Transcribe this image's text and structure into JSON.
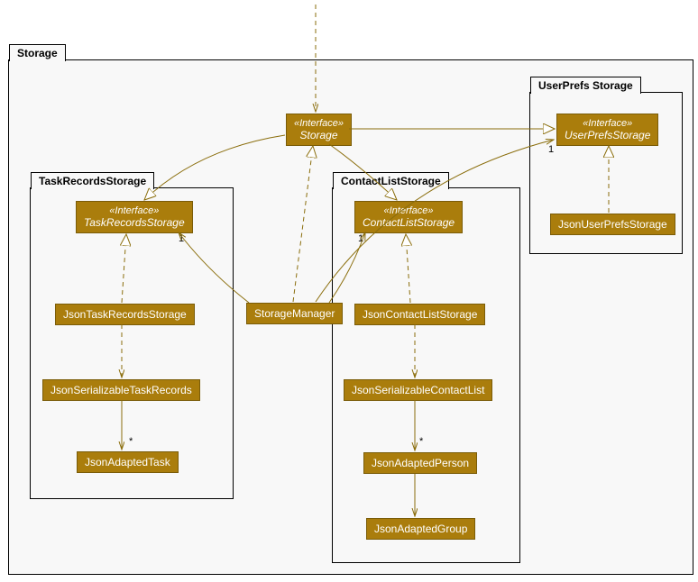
{
  "chart_data": {
    "type": "uml_class_diagram",
    "packages": [
      {
        "name": "Storage",
        "children": [
          "TaskRecordsStorage",
          "ContactListStorage",
          "UserPrefs Storage",
          "Storage",
          "StorageManager"
        ]
      },
      {
        "name": "TaskRecordsStorage",
        "children": [
          "TaskRecordsStorage",
          "JsonTaskRecordsStorage",
          "JsonSerializableTaskRecords",
          "JsonAdaptedTask"
        ]
      },
      {
        "name": "ContactListStorage",
        "children": [
          "ContactListStorage",
          "JsonContactListStorage",
          "JsonSerializableContactList",
          "JsonAdaptedPerson",
          "JsonAdaptedGroup"
        ]
      },
      {
        "name": "UserPrefs Storage",
        "children": [
          "UserPrefsStorage",
          "JsonUserPrefsStorage"
        ]
      }
    ],
    "elements": [
      {
        "id": "Storage",
        "stereotype": "«Interface»",
        "name": "Storage",
        "type": "interface"
      },
      {
        "id": "StorageManager",
        "name": "StorageManager",
        "type": "class"
      },
      {
        "id": "TaskRecordsStorage",
        "stereotype": "«Interface»",
        "name": "TaskRecordsStorage",
        "type": "interface"
      },
      {
        "id": "JsonTaskRecordsStorage",
        "name": "JsonTaskRecordsStorage",
        "type": "class"
      },
      {
        "id": "JsonSerializableTaskRecords",
        "name": "JsonSerializableTaskRecords",
        "type": "class"
      },
      {
        "id": "JsonAdaptedTask",
        "name": "JsonAdaptedTask",
        "type": "class"
      },
      {
        "id": "ContactListStorage",
        "stereotype": "«Interface»",
        "name": "ContactListStorage",
        "type": "interface"
      },
      {
        "id": "JsonContactListStorage",
        "name": "JsonContactListStorage",
        "type": "class"
      },
      {
        "id": "JsonSerializableContactList",
        "name": "JsonSerializableContactList",
        "type": "class"
      },
      {
        "id": "JsonAdaptedPerson",
        "name": "JsonAdaptedPerson",
        "type": "class"
      },
      {
        "id": "JsonAdaptedGroup",
        "name": "JsonAdaptedGroup",
        "type": "class"
      },
      {
        "id": "UserPrefsStorage",
        "stereotype": "«Interface»",
        "name": "UserPrefsStorage",
        "type": "interface"
      },
      {
        "id": "JsonUserPrefsStorage",
        "name": "JsonUserPrefsStorage",
        "type": "class"
      }
    ],
    "relationships": [
      {
        "from": "external",
        "to": "Storage",
        "type": "dependency"
      },
      {
        "from": "Storage",
        "to": "TaskRecordsStorage",
        "type": "generalization"
      },
      {
        "from": "Storage",
        "to": "ContactListStorage",
        "type": "generalization"
      },
      {
        "from": "Storage",
        "to": "UserPrefsStorage",
        "type": "generalization"
      },
      {
        "from": "StorageManager",
        "to": "Storage",
        "type": "realization"
      },
      {
        "from": "StorageManager",
        "to": "TaskRecordsStorage",
        "type": "association",
        "multiplicity": "1"
      },
      {
        "from": "StorageManager",
        "to": "ContactListStorage",
        "type": "association",
        "multiplicity": "1"
      },
      {
        "from": "StorageManager",
        "to": "UserPrefsStorage",
        "type": "association",
        "multiplicity": "1"
      },
      {
        "from": "JsonTaskRecordsStorage",
        "to": "TaskRecordsStorage",
        "type": "realization"
      },
      {
        "from": "JsonTaskRecordsStorage",
        "to": "JsonSerializableTaskRecords",
        "type": "dependency"
      },
      {
        "from": "JsonSerializableTaskRecords",
        "to": "JsonAdaptedTask",
        "type": "association",
        "multiplicity": "*"
      },
      {
        "from": "JsonContactListStorage",
        "to": "ContactListStorage",
        "type": "realization"
      },
      {
        "from": "JsonContactListStorage",
        "to": "JsonSerializableContactList",
        "type": "dependency"
      },
      {
        "from": "JsonSerializableContactList",
        "to": "JsonAdaptedPerson",
        "type": "association",
        "multiplicity": "*"
      },
      {
        "from": "JsonAdaptedPerson",
        "to": "JsonAdaptedGroup",
        "type": "association"
      },
      {
        "from": "JsonUserPrefsStorage",
        "to": "UserPrefsStorage",
        "type": "realization"
      }
    ]
  },
  "pkg": {
    "storage": "Storage",
    "task": "TaskRecordsStorage",
    "contact": "ContactListStorage",
    "userprefs": "UserPrefs Storage"
  },
  "el": {
    "storage_stereo": "«Interface»",
    "storage_name": "Storage",
    "storagemanager": "StorageManager",
    "taskrecords_stereo": "«Interface»",
    "taskrecords_name": "TaskRecordsStorage",
    "jsontaskrecords": "JsonTaskRecordsStorage",
    "jsonserializabletask": "JsonSerializableTaskRecords",
    "jsonadaptedtask": "JsonAdaptedTask",
    "contactlist_stereo": "«Interface»",
    "contactlist_name": "ContactListStorage",
    "jsoncontactlist": "JsonContactListStorage",
    "jsonserializablecontact": "JsonSerializableContactList",
    "jsonadaptedperson": "JsonAdaptedPerson",
    "jsonadaptedgroup": "JsonAdaptedGroup",
    "userprefs_stereo": "«Interface»",
    "userprefs_name": "UserPrefsStorage",
    "jsonuserprefs": "JsonUserPrefsStorage"
  },
  "mult": {
    "one": "1",
    "many": "*"
  }
}
